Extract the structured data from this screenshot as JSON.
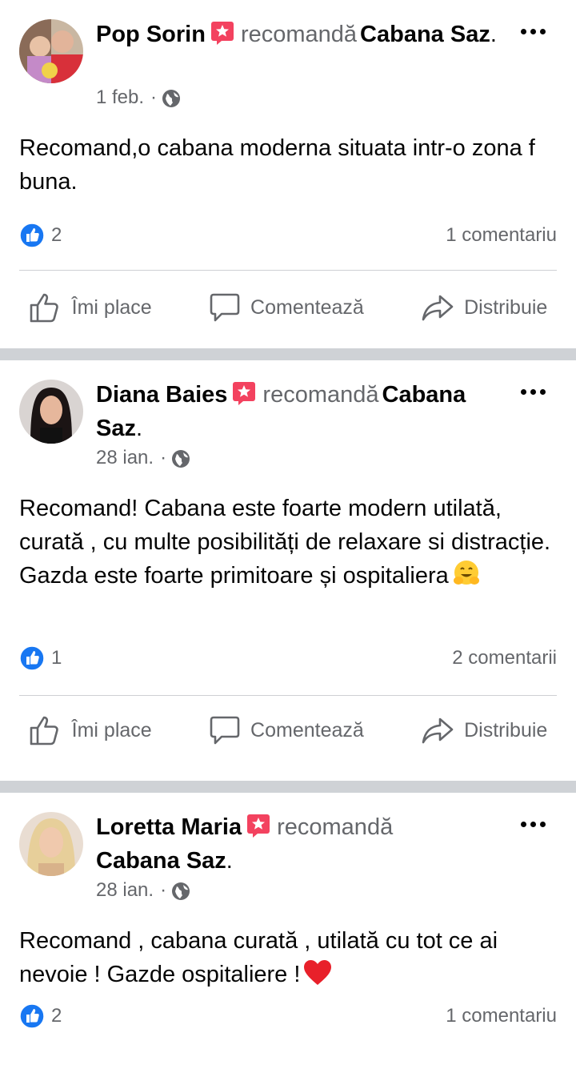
{
  "posts": [
    {
      "author": "Pop Sorin",
      "verb": "recomandă",
      "page": "Cabana Saz",
      "date": "1 feb.",
      "text": "Recomand,o cabana moderna situata intr-o zona f buna.",
      "likes": "2",
      "comments": "1 comentariu"
    },
    {
      "author": "Diana Baies",
      "verb": "recomandă",
      "page": "Cabana Saz",
      "date": "28 ian.",
      "text": "Recomand! Cabana este foarte modern utilată, curată , cu multe posibilități de relaxare si distracție. Gazda este foarte primitoare și ospitaliera",
      "emoji": "hugging-face-emoji",
      "likes": "1",
      "comments": "2 comentarii"
    },
    {
      "author": "Loretta Maria",
      "verb": "recomandă",
      "page": "Cabana Saz",
      "date": "28 ian.",
      "text": "Recomand , cabana curată ,  utilată cu tot ce ai nevoie ! Gazde ospitaliere !",
      "emoji": "red-heart-emoji",
      "likes": "2",
      "comments": "1 comentariu"
    }
  ],
  "actions": {
    "like": "Îmi place",
    "comment": "Comentează",
    "share": "Distribuie"
  },
  "colors": {
    "recommend_badge": "#f3425f",
    "like_blue": "#1877f2",
    "secondary_text": "#65676b",
    "separator": "#cfd2d6"
  },
  "icons": [
    "recommend-badge-icon",
    "globe-icon",
    "more-options-icon",
    "like-reaction-icon",
    "thumbs-up-icon",
    "comment-icon",
    "share-icon"
  ]
}
